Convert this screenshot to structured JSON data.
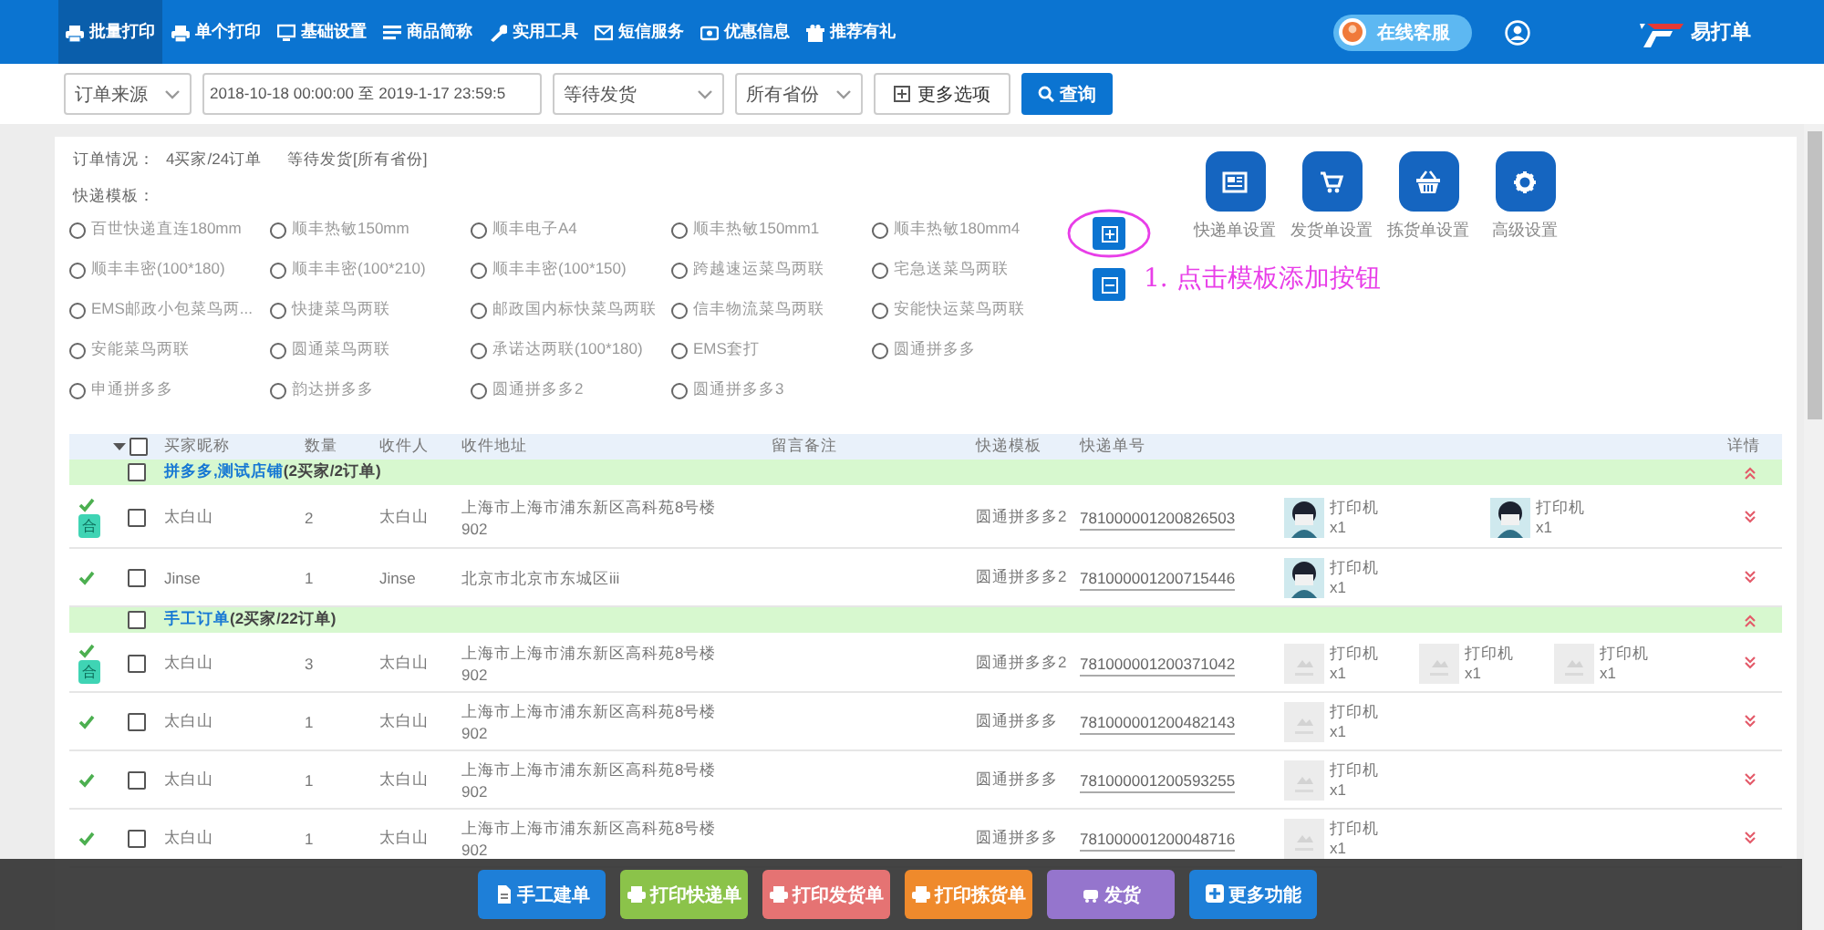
{
  "nav": {
    "items": [
      {
        "label": "批量打印",
        "selected": true
      },
      {
        "label": "单个打印",
        "selected": false
      },
      {
        "label": "基础设置",
        "selected": false
      },
      {
        "label": "商品简称",
        "selected": false
      },
      {
        "label": "实用工具",
        "selected": false
      },
      {
        "label": "短信服务",
        "selected": false
      },
      {
        "label": "优惠信息",
        "selected": false
      },
      {
        "label": "推荐有礼",
        "selected": false
      }
    ],
    "service": "在线客服",
    "logo": "易打单"
  },
  "filters": {
    "source": "订单来源",
    "date_range": "2018-10-18 00:00:00 至 2019-1-17 23:59:5",
    "status": "等待发货",
    "province": "所有省份",
    "more": "更多选项",
    "search": "查询"
  },
  "summary": {
    "label": "订单情况：",
    "count": "4买家/24订单",
    "filter": "等待发货[所有省份]"
  },
  "templates": {
    "label": "快递模板：",
    "options": [
      {
        "label": "百世快递直连180mm",
        "selected": false
      },
      {
        "label": "顺丰热敏150mm",
        "selected": false
      },
      {
        "label": "顺丰电子A4",
        "selected": false
      },
      {
        "label": "顺丰热敏150mm1",
        "selected": false
      },
      {
        "label": "顺丰热敏180mm4",
        "selected": false
      },
      {
        "label": "顺丰丰密(100*180)",
        "selected": false
      },
      {
        "label": "顺丰丰密(100*210)",
        "selected": false
      },
      {
        "label": "顺丰丰密(100*150)",
        "selected": false
      },
      {
        "label": "跨越速运菜鸟两联",
        "selected": false
      },
      {
        "label": "宅急送菜鸟两联",
        "selected": false
      },
      {
        "label": "EMS邮政小包菜鸟两...",
        "selected": false
      },
      {
        "label": "快捷菜鸟两联",
        "selected": false
      },
      {
        "label": "邮政国内标快菜鸟两联",
        "selected": false
      },
      {
        "label": "信丰物流菜鸟两联",
        "selected": false
      },
      {
        "label": "安能快运菜鸟两联",
        "selected": false
      },
      {
        "label": "安能菜鸟两联",
        "selected": false
      },
      {
        "label": "圆通菜鸟两联",
        "selected": false
      },
      {
        "label": "承诺达两联(100*180)",
        "selected": false
      },
      {
        "label": "EMS套打",
        "selected": false
      },
      {
        "label": "圆通拼多多",
        "selected": false
      },
      {
        "label": "申通拼多多",
        "selected": false
      },
      {
        "label": "韵达拼多多",
        "selected": false
      },
      {
        "label": "圆通拼多多2",
        "selected": false
      },
      {
        "label": "圆通拼多多3",
        "selected": false
      }
    ]
  },
  "settings": [
    {
      "label": "快递单设置"
    },
    {
      "label": "发货单设置"
    },
    {
      "label": "拣货单设置"
    },
    {
      "label": "高级设置"
    }
  ],
  "annotation": "1. 点击模板添加按钮",
  "table": {
    "columns": [
      "买家昵称",
      "数量",
      "收件人",
      "收件地址",
      "留言备注",
      "快递模板",
      "快递单号",
      "详情"
    ],
    "checked": false,
    "groups": [
      {
        "name": "拼多多,测试店铺",
        "summary": "(2买家/2订单)",
        "checked": false,
        "expanded": true,
        "rows": [
          {
            "done": true,
            "badge": "合",
            "checked": false,
            "buyer": "太白山",
            "quantity": "2",
            "recipient": "太白山",
            "address": [
              "上海市上海市浦东新区高科苑8号楼",
              "902"
            ],
            "template": "圆通拼多多2",
            "tracking": "781000001200826503",
            "expanded": false,
            "printers": [
              {
                "kind": "avatar",
                "label": "打印机",
                "count": "x1"
              },
              {
                "kind": "avatar",
                "label": "打印机",
                "count": "x1"
              }
            ]
          },
          {
            "done": true,
            "checked": false,
            "buyer": "Jinse",
            "quantity": "1",
            "recipient": "Jinse",
            "address": [
              "北京市北京市东城区iii"
            ],
            "template": "圆通拼多多2",
            "tracking": "781000001200715446",
            "expanded": false,
            "printers": [
              {
                "kind": "avatar",
                "label": "打印机",
                "count": "x1"
              }
            ]
          }
        ]
      },
      {
        "name": "手工订单",
        "summary": "(2买家/22订单)",
        "checked": false,
        "expanded": true,
        "rows": [
          {
            "done": true,
            "badge": "合",
            "checked": false,
            "buyer": "太白山",
            "quantity": "3",
            "recipient": "太白山",
            "address": [
              "上海市上海市浦东新区高科苑8号楼",
              "902"
            ],
            "template": "圆通拼多多2",
            "tracking": "781000001200371042",
            "expanded": false,
            "printers": [
              {
                "kind": "placeholder",
                "label": "打印机",
                "count": "x1"
              },
              {
                "kind": "placeholder",
                "label": "打印机",
                "count": "x1"
              },
              {
                "kind": "placeholder",
                "label": "打印机",
                "count": "x1"
              }
            ]
          },
          {
            "done": true,
            "checked": false,
            "buyer": "太白山",
            "quantity": "1",
            "recipient": "太白山",
            "address": [
              "上海市上海市浦东新区高科苑8号楼",
              "902"
            ],
            "template": "圆通拼多多",
            "tracking": "781000001200482143",
            "expanded": false,
            "printers": [
              {
                "kind": "placeholder",
                "label": "打印机",
                "count": "x1"
              }
            ]
          },
          {
            "done": true,
            "checked": false,
            "buyer": "太白山",
            "quantity": "1",
            "recipient": "太白山",
            "address": [
              "上海市上海市浦东新区高科苑8号楼",
              "902"
            ],
            "template": "圆通拼多多",
            "tracking": "781000001200593255",
            "expanded": false,
            "printers": [
              {
                "kind": "placeholder",
                "label": "打印机",
                "count": "x1"
              }
            ]
          },
          {
            "done": true,
            "checked": false,
            "buyer": "太白山",
            "quantity": "1",
            "recipient": "太白山",
            "address": [
              "上海市上海市浦东新区高科苑8号楼",
              "902"
            ],
            "template": "圆通拼多多",
            "tracking": "781000001200048716",
            "expanded": false,
            "printers": [
              {
                "kind": "placeholder",
                "label": "打印机",
                "count": "x1"
              }
            ]
          }
        ]
      }
    ]
  },
  "actions": [
    {
      "label": "手工建单",
      "color": "#1e7fd8"
    },
    {
      "label": "打印快递单",
      "color": "#8bc34a"
    },
    {
      "label": "打印发货单",
      "color": "#e57373"
    },
    {
      "label": "打印拣货单",
      "color": "#ef8a2c"
    },
    {
      "label": "发货",
      "color": "#9575cd"
    },
    {
      "label": "更多功能",
      "color": "#1e7fd8"
    }
  ]
}
